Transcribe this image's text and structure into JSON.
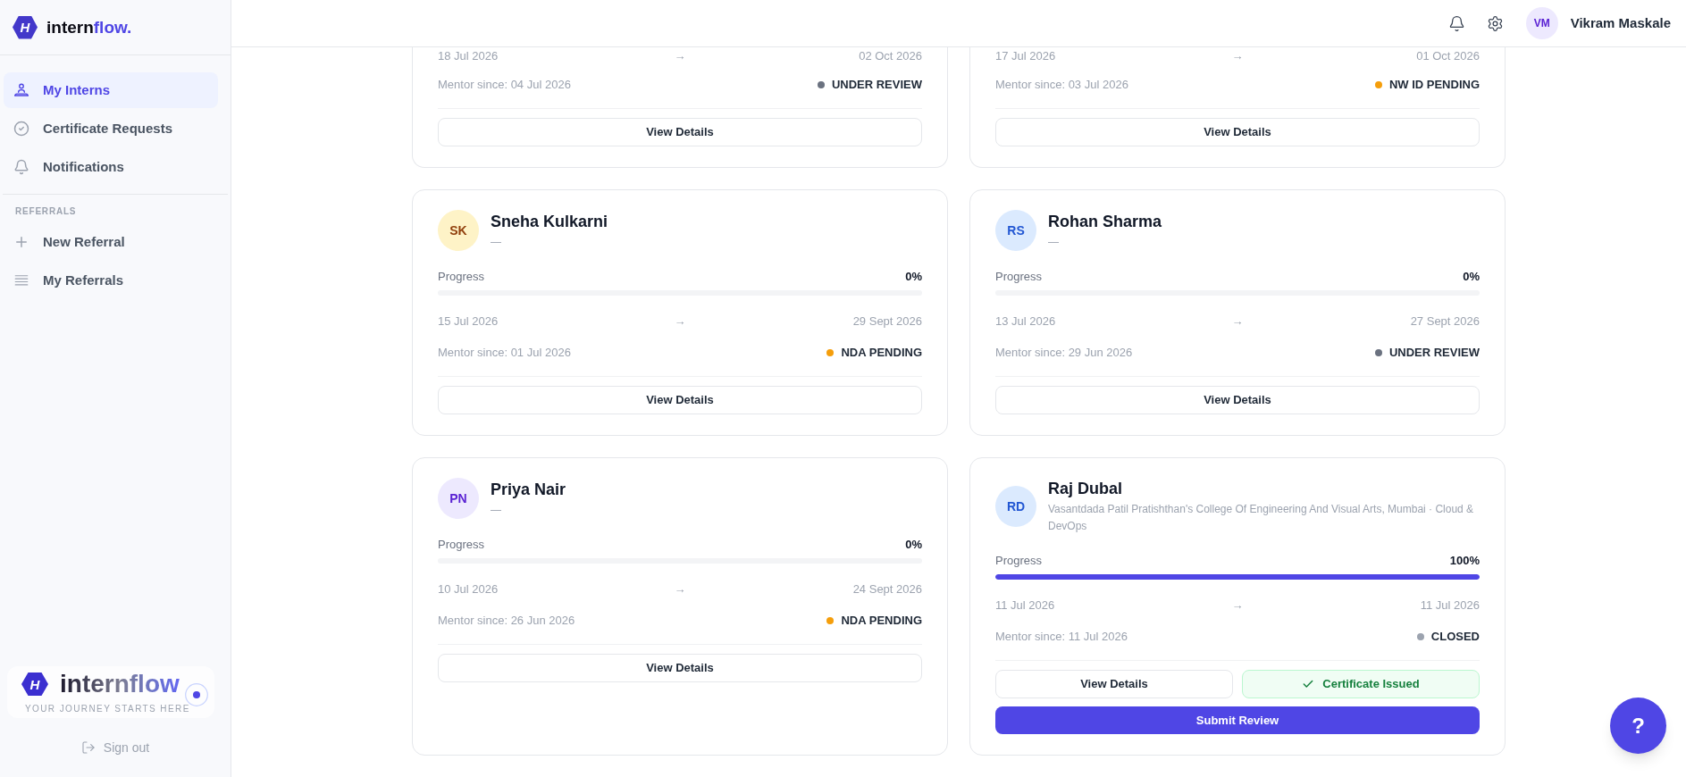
{
  "sidebar": {
    "logo": {
      "letter": "H",
      "text": "intern",
      "accent_text": "flow."
    },
    "nav": [
      {
        "label": "My Interns",
        "selected": true
      },
      {
        "label": "Certificate Requests",
        "selected": false
      },
      {
        "label": "Notifications",
        "selected": false
      }
    ],
    "sections": [
      {
        "heading": "REFERRALS",
        "items": [
          {
            "label": "New Referral",
            "selected": false
          },
          {
            "label": "My Referrals",
            "selected": false
          }
        ]
      }
    ],
    "promo": {
      "letter": "H",
      "wordmark": "internflow",
      "tagline": "YOUR JOURNEY STARTS HERE"
    },
    "sign_out": "Sign out"
  },
  "header": {
    "user": {
      "initials": "VM",
      "name": "Vikram Maskale",
      "color": "#ede9fe"
    }
  },
  "interns": [
    {
      "clipped": true,
      "start": "18 Jul 2026",
      "arrow": "→",
      "end": "02 Oct 2026",
      "mentor_since": "Mentor since: 04 Jul 2026",
      "status": {
        "label": "UNDER REVIEW",
        "color": "#6b7280"
      },
      "actions": [
        {
          "label": "View Details",
          "kind": "outline"
        }
      ]
    },
    {
      "clipped": true,
      "start": "17 Jul 2026",
      "arrow": "→",
      "end": "01 Oct 2026",
      "mentor_since": "Mentor since: 03 Jul 2026",
      "status": {
        "label": "NW ID PENDING",
        "color": "#f59e0b"
      },
      "actions": [
        {
          "label": "View Details",
          "kind": "outline"
        }
      ]
    },
    {
      "clipped": false,
      "avatar": {
        "initials": "SK",
        "color": "#fef3c7"
      },
      "name": "Sneha Kulkarni",
      "subtitle": "—",
      "progress": {
        "label": "Progress",
        "value": "0%",
        "level": 0
      },
      "start": "15 Jul 2026",
      "arrow": "→",
      "end": "29 Sept 2026",
      "mentor_since": "Mentor since: 01 Jul 2026",
      "status": {
        "label": "NDA PENDING",
        "color": "#f59e0b"
      },
      "actions": [
        {
          "label": "View Details",
          "kind": "outline"
        }
      ]
    },
    {
      "clipped": false,
      "avatar": {
        "initials": "RS",
        "color": "#dbeafe"
      },
      "name": "Rohan Sharma",
      "subtitle": "—",
      "progress": {
        "label": "Progress",
        "value": "0%",
        "level": 0
      },
      "start": "13 Jul 2026",
      "arrow": "→",
      "end": "27 Sept 2026",
      "mentor_since": "Mentor since: 29 Jun 2026",
      "status": {
        "label": "UNDER REVIEW",
        "color": "#6b7280"
      },
      "actions": [
        {
          "label": "View Details",
          "kind": "outline"
        }
      ]
    },
    {
      "clipped": false,
      "avatar": {
        "initials": "PN",
        "color": "#ede9fe"
      },
      "name": "Priya Nair",
      "subtitle": "—",
      "progress": {
        "label": "Progress",
        "value": "0%",
        "level": 0
      },
      "start": "10 Jul 2026",
      "arrow": "→",
      "end": "24 Sept 2026",
      "mentor_since": "Mentor since: 26 Jun 2026",
      "status": {
        "label": "NDA PENDING",
        "color": "#f59e0b"
      },
      "actions": [
        {
          "label": "View Details",
          "kind": "outline"
        }
      ]
    },
    {
      "clipped": false,
      "avatar": {
        "initials": "RD",
        "color": "#dbeafe"
      },
      "name": "Raj Dubal",
      "subtitle": "Vasantdada Patil Pratishthan's College Of Engineering And Visual Arts, Mumbai · Cloud & DevOps",
      "progress": {
        "label": "Progress",
        "value": "100%",
        "level": 1
      },
      "start": "11 Jul 2026",
      "arrow": "→",
      "end": "11 Jul 2026",
      "mentor_since": "Mentor since: 11 Jul 2026",
      "status": {
        "label": "CLOSED",
        "color": "#9ca3af"
      },
      "actions": [
        {
          "label": "View Details",
          "kind": "outline"
        },
        {
          "label": "Certificate Issued",
          "kind": "issued"
        },
        {
          "label": "Submit Review",
          "kind": "primary"
        }
      ]
    }
  ],
  "help_button": "?"
}
